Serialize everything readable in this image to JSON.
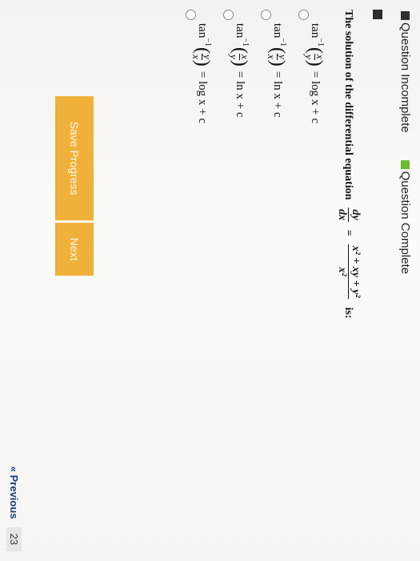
{
  "legend": {
    "incomplete_label": "Question Incomplete",
    "complete_label": "Question Complete",
    "colors": {
      "incomplete": "#2f2f2f",
      "complete": "#6dbb2f"
    }
  },
  "question": {
    "text": "The solution of the differential equation",
    "lhs_num": "dy",
    "lhs_den": "dx",
    "eq": "=",
    "rhs_num": "x² + xy + y²",
    "rhs_den": "x²",
    "suffix": "is:"
  },
  "options": [
    {
      "fn": "tan",
      "sup": "−1",
      "num": "x",
      "den": "y",
      "rhs": "= log x + c"
    },
    {
      "fn": "tan",
      "sup": "−1",
      "num": "y",
      "den": "x",
      "rhs": "= ln x + c"
    },
    {
      "fn": "tan",
      "sup": "−1",
      "num": "x",
      "den": "y",
      "rhs": "= ln x + c"
    },
    {
      "fn": "tan",
      "sup": "−1",
      "num": "y",
      "den": "x",
      "rhs": "= log x + c"
    }
  ],
  "buttons": {
    "save_label": "Save Progress",
    "next_label": "Next",
    "color": "#efb13a"
  },
  "pager": {
    "prev_label": "« Previous",
    "page_number": "23"
  }
}
